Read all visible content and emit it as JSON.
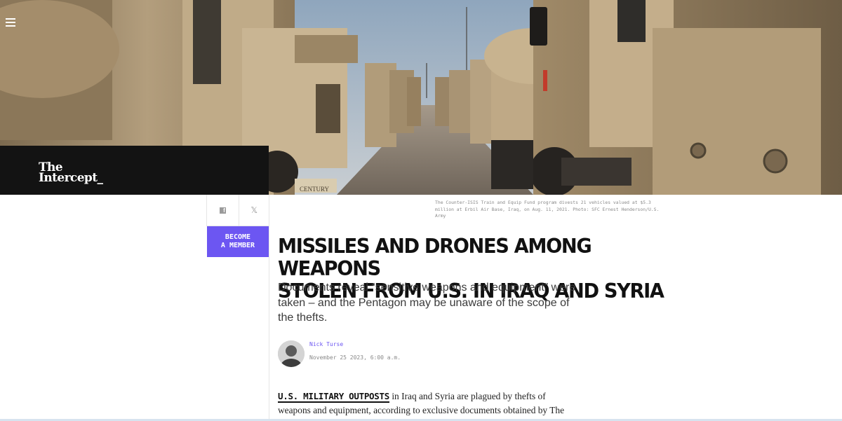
{
  "site": {
    "logo_line1": "The",
    "logo_line2": "Intercept"
  },
  "nav": {
    "menu_icon": "hamburger-menu-icon"
  },
  "hero": {
    "caption": "The Counter-ISIS Train and Equip Fund program divests 21 vehicles valued at $5.3 million at Erbil Air Base, Iraq, on Aug. 11, 2021. Photo: SFC Ernest Henderson/U.S. Army",
    "truck_badge": "CENTURY"
  },
  "share": {
    "facebook_icon": "facebook-icon",
    "x_icon": "x-icon",
    "x_glyph": "𝕏",
    "member_line1": "Become",
    "member_line2": "a member"
  },
  "article": {
    "headline_line1": "MISSILES AND DRONES AMONG WEAPONS",
    "headline_line2": "STOLEN FROM U.S. IN IRAQ AND SYRIA",
    "dek": "Documents reveal “sensitive weapons and equipment” were taken – and the Pentagon may be unaware of the scope of the thefts.",
    "author": "Nick Turse",
    "date": "November 25 2023, 6:00 a.m.",
    "lead_in": "U.S. MILITARY OUTPOSTS",
    "body_start": " in Iraq and Syria are plagued by thefts of weapons and equipment, according to exclusive documents obtained by The Intercept through multiple public records",
    "body_fragment": ""
  },
  "colors": {
    "accent": "#6c56f2",
    "logo_bg": "#131313"
  }
}
